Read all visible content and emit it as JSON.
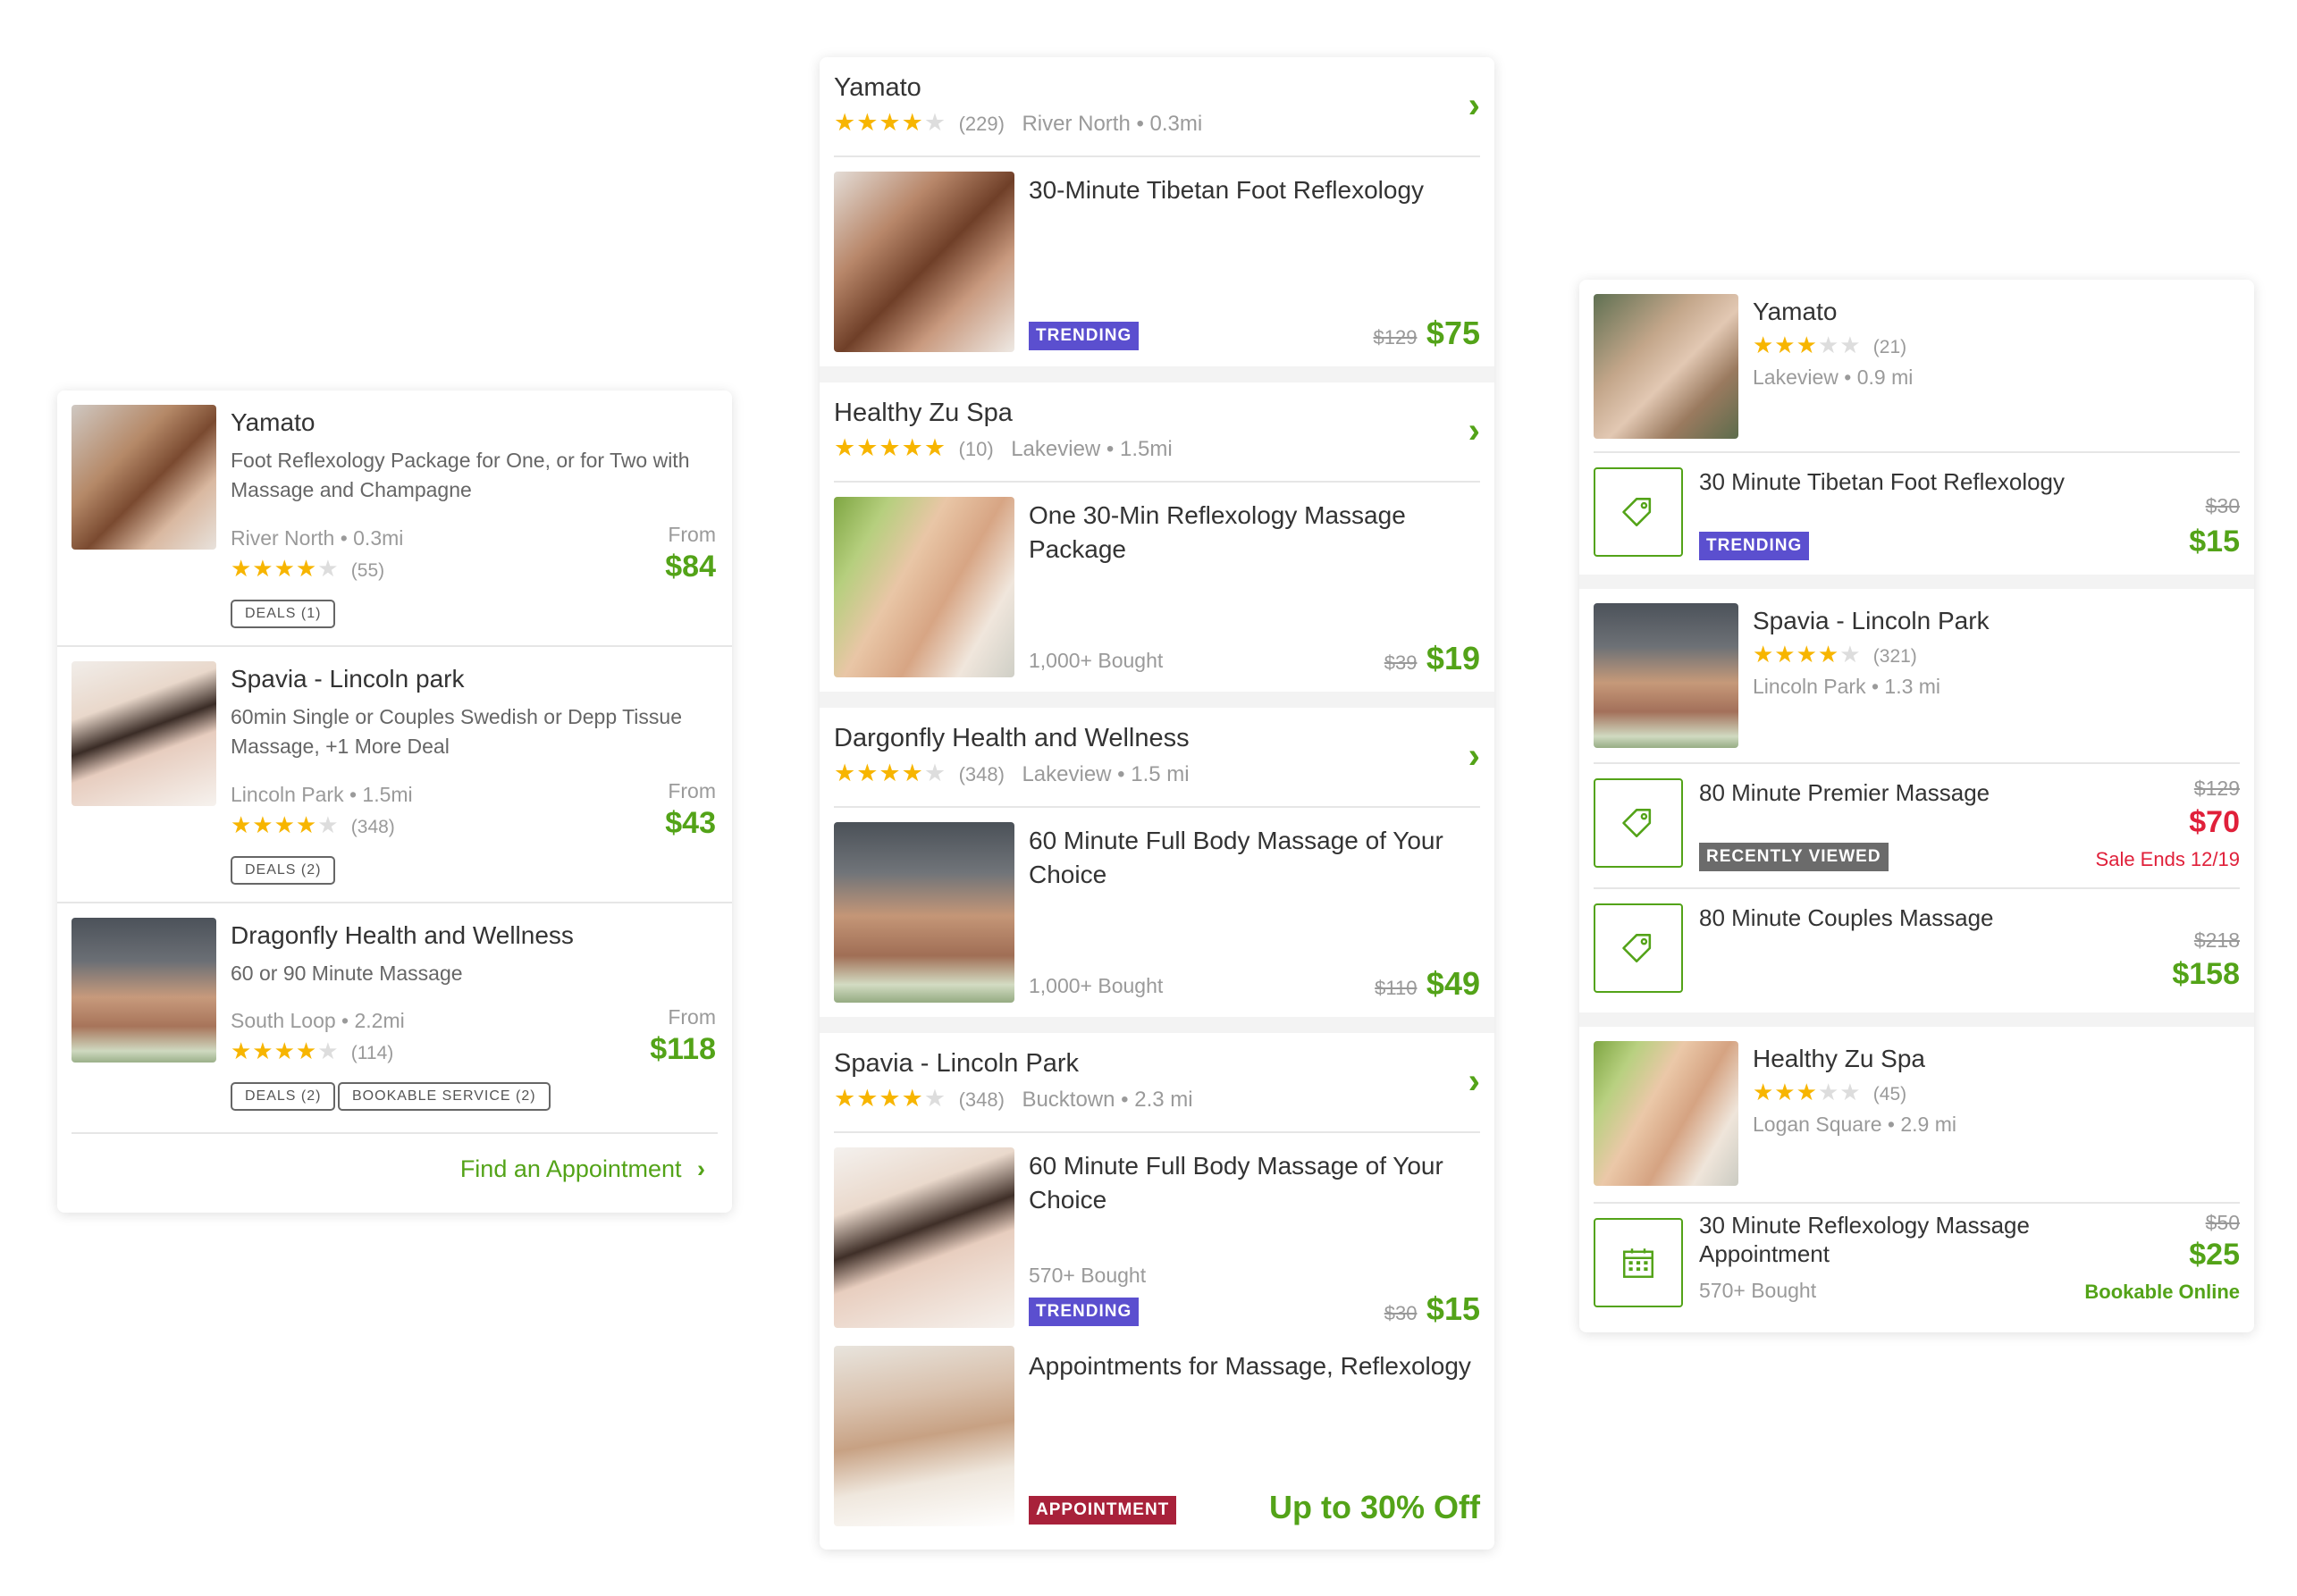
{
  "left": {
    "items": [
      {
        "name": "Yamato",
        "desc": "Foot Reflexology Package for One, or for Two with Massage and Champagne",
        "location": "River North • 0.3mi",
        "reviews": "(55)",
        "rating": 4,
        "from": "From",
        "price": "$84",
        "badges": [
          "DEALS (1)"
        ]
      },
      {
        "name": "Spavia - Lincoln park",
        "desc": "60min Single or Couples Swedish or Depp Tissue Massage, +1 More Deal",
        "location": "Lincoln Park • 1.5mi",
        "reviews": "(348)",
        "rating": 4,
        "from": "From",
        "price": "$43",
        "badges": [
          "DEALS (2)"
        ]
      },
      {
        "name": "Dragonfly Health and Wellness",
        "desc": "60 or 90 Minute Massage",
        "location": "South Loop • 2.2mi",
        "reviews": "(114)",
        "rating": 4,
        "from": "From",
        "price": "$118",
        "badges": [
          "DEALS (2)",
          "BOOKABLE SERVICE (2)"
        ]
      }
    ],
    "find_link": "Find an Appointment"
  },
  "middle": {
    "sections": [
      {
        "merchant": "Yamato",
        "reviews": "(229)",
        "rating": 4,
        "location": "River North • 0.3mi",
        "deal": {
          "title": "30-Minute Tibetan Foot Reflexology",
          "tag": "TRENDING",
          "bought": "",
          "old": "$129",
          "price": "$75"
        }
      },
      {
        "merchant": "Healthy Zu Spa",
        "reviews": "(10)",
        "rating": 5,
        "location": "Lakeview • 1.5mi",
        "deal": {
          "title": "One 30-Min Reflexology Massage Package",
          "tag": "",
          "bought": "1,000+ Bought",
          "old": "$39",
          "price": "$19"
        }
      },
      {
        "merchant": "Dargonfly Health and Wellness",
        "reviews": "(348)",
        "rating": 4,
        "location": "Lakeview • 1.5 mi",
        "deal": {
          "title": "60 Minute Full Body Massage of Your Choice",
          "tag": "",
          "bought": "1,000+ Bought",
          "old": "$110",
          "price": "$49"
        }
      },
      {
        "merchant": "Spavia - Lincoln Park",
        "reviews": "(348)",
        "rating": 4,
        "location": "Bucktown • 2.3 mi",
        "deal": {
          "title": "60 Minute Full Body Massage of Your Choice",
          "tag": "TRENDING",
          "bought": "570+ Bought",
          "old": "$30",
          "price": "$15"
        },
        "deal2": {
          "title": "Appointments for Massage, Reflexology",
          "tag": "APPOINTMENT",
          "offer": "Up to 30% Off"
        }
      }
    ]
  },
  "right": {
    "groups": [
      {
        "merchant": "Yamato",
        "reviews": "(21)",
        "rating": 3,
        "location": "Lakeview • 0.9 mi",
        "deals": [
          {
            "icon": "price-tag-icon",
            "title": "30 Minute Tibetan Foot Reflexology",
            "tag": "TRENDING",
            "old": "$30",
            "price": "$15",
            "note": ""
          }
        ]
      },
      {
        "merchant": "Spavia - Lincoln Park",
        "reviews": "(321)",
        "rating": 4,
        "location": "Lincoln Park • 1.3 mi",
        "deals": [
          {
            "icon": "price-tag-icon",
            "title": "80 Minute Premier Massage",
            "tag": "RECENTLY VIEWED",
            "old": "$129",
            "price": "$70",
            "note": "Sale Ends 12/19"
          },
          {
            "icon": "price-tag-icon",
            "title": "80 Minute Couples Massage",
            "tag": "",
            "old": "$218",
            "price": "$158",
            "note": ""
          }
        ]
      },
      {
        "merchant": "Healthy Zu Spa",
        "reviews": "(45)",
        "rating": 3,
        "location": "Logan Square • 2.9 mi",
        "deals": [
          {
            "icon": "calendar-icon",
            "title": "30 Minute Reflexology Massage Appointment",
            "bought": "570+ Bought",
            "old": "$50",
            "price": "$25",
            "note": "Bookable Online"
          }
        ]
      }
    ]
  },
  "colors": {
    "accent": "#53a318",
    "trending": "#5b4fcf",
    "recent": "#6b6b6b",
    "appointment": "#a8213a",
    "sale": "#e0203a",
    "star": "#f7b500"
  }
}
